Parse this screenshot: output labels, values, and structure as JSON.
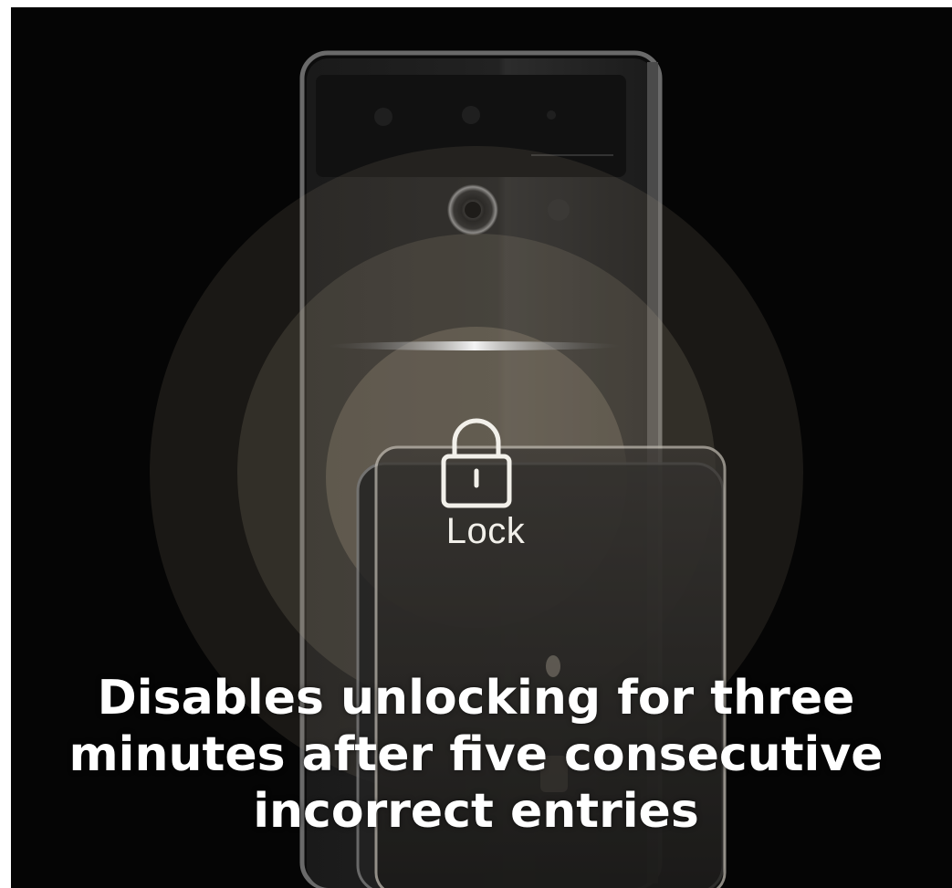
{
  "product_image": {
    "lock_label": "Lock",
    "lock_icon": "padlock-icon"
  },
  "caption": {
    "lines": [
      "Disables unlocking for three",
      "minutes after five consecutive",
      "incorrect entries"
    ]
  },
  "colors": {
    "background": "#050505",
    "caption_text": "#ffffff",
    "glow": "#c8b89a"
  }
}
